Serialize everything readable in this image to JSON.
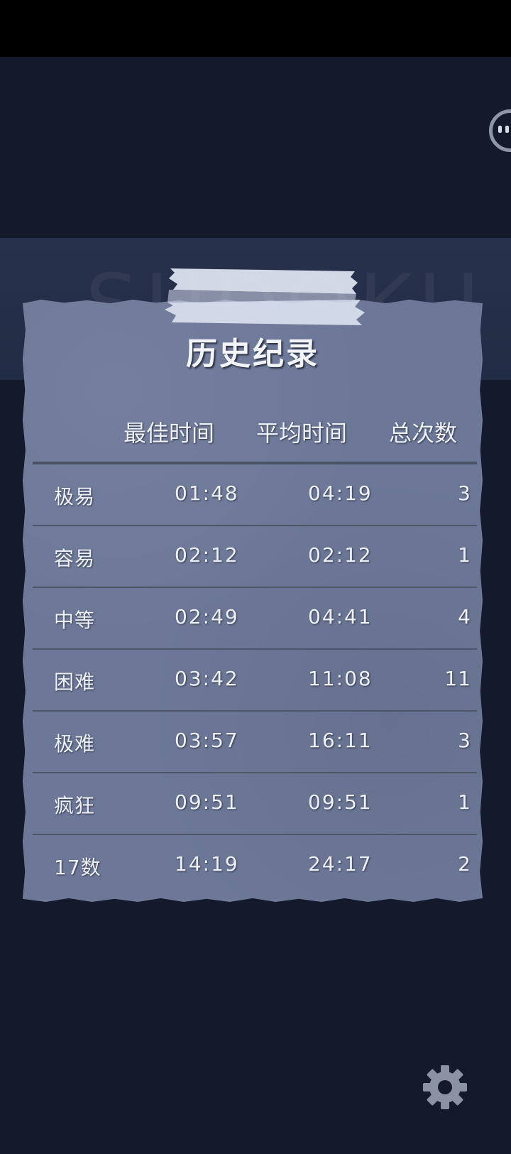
{
  "app": {
    "background_title": "SUDOKU"
  },
  "dialog": {
    "title": "历史纪录",
    "columns": {
      "best": "最佳时间",
      "average": "平均时间",
      "total": "总次数"
    },
    "rows": [
      {
        "level": "极易",
        "best": "01:48",
        "average": "04:19",
        "count": "3"
      },
      {
        "level": "容易",
        "best": "02:12",
        "average": "02:12",
        "count": "1"
      },
      {
        "level": "中等",
        "best": "02:49",
        "average": "04:41",
        "count": "4"
      },
      {
        "level": "困难",
        "best": "03:42",
        "average": "11:08",
        "count": "11"
      },
      {
        "level": "极难",
        "best": "03:57",
        "average": "16:11",
        "count": "3"
      },
      {
        "level": "疯狂",
        "best": "09:51",
        "average": "09:51",
        "count": "1"
      },
      {
        "level": "17数",
        "best": "14:19",
        "average": "24:17",
        "count": "2"
      }
    ]
  },
  "icons": {
    "settings": "gear-icon",
    "mascot": "mascot-face-icon"
  },
  "colors": {
    "background": "#141a2b",
    "card": "#6d7898",
    "text": "#eef1f6"
  }
}
